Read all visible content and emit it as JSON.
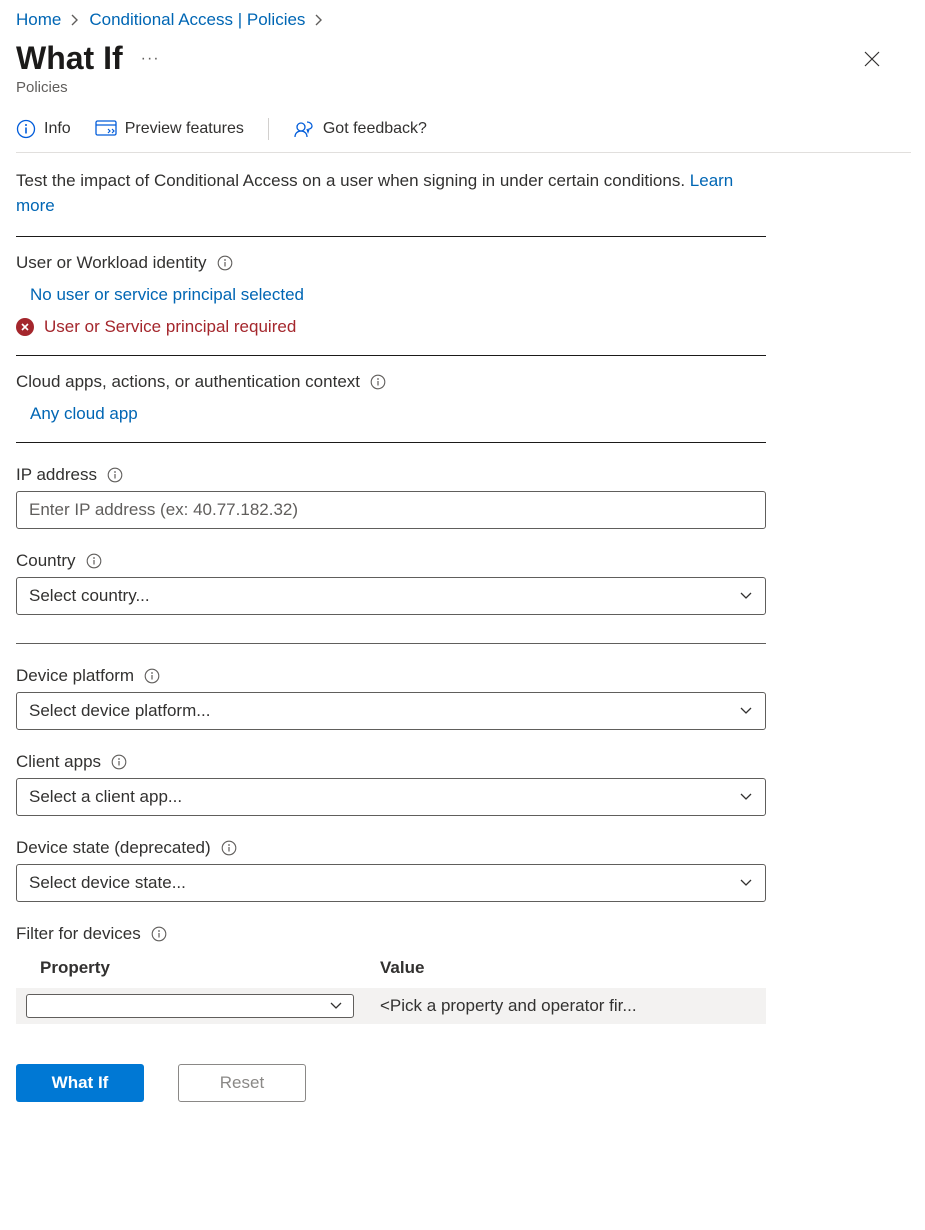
{
  "breadcrumb": {
    "home": "Home",
    "conditional": "Conditional Access | Policies"
  },
  "page": {
    "title": "What If",
    "subtitle": "Policies"
  },
  "toolbar": {
    "info": "Info",
    "preview": "Preview features",
    "feedback": "Got feedback?"
  },
  "intro": {
    "text": "Test the impact of Conditional Access on a user when signing in under certain conditions. ",
    "learn": "Learn more"
  },
  "sections": {
    "identity": {
      "label": "User or Workload identity",
      "link": "No user or service principal selected",
      "error": "User or Service principal required"
    },
    "cloudapps": {
      "label": "Cloud apps, actions, or authentication context",
      "link": "Any cloud app"
    }
  },
  "fields": {
    "ip": {
      "label": "IP address",
      "placeholder": "Enter IP address (ex: 40.77.182.32)"
    },
    "country": {
      "label": "Country",
      "placeholder": "Select country..."
    },
    "device_platform": {
      "label": "Device platform",
      "placeholder": "Select device platform..."
    },
    "client_apps": {
      "label": "Client apps",
      "placeholder": "Select a client app..."
    },
    "device_state": {
      "label": "Device state (deprecated)",
      "placeholder": "Select device state..."
    },
    "filter_devices": {
      "label": "Filter for devices",
      "col_property": "Property",
      "col_value": "Value",
      "value_placeholder": "<Pick a property and operator fir..."
    }
  },
  "buttons": {
    "whatif": "What If",
    "reset": "Reset"
  }
}
